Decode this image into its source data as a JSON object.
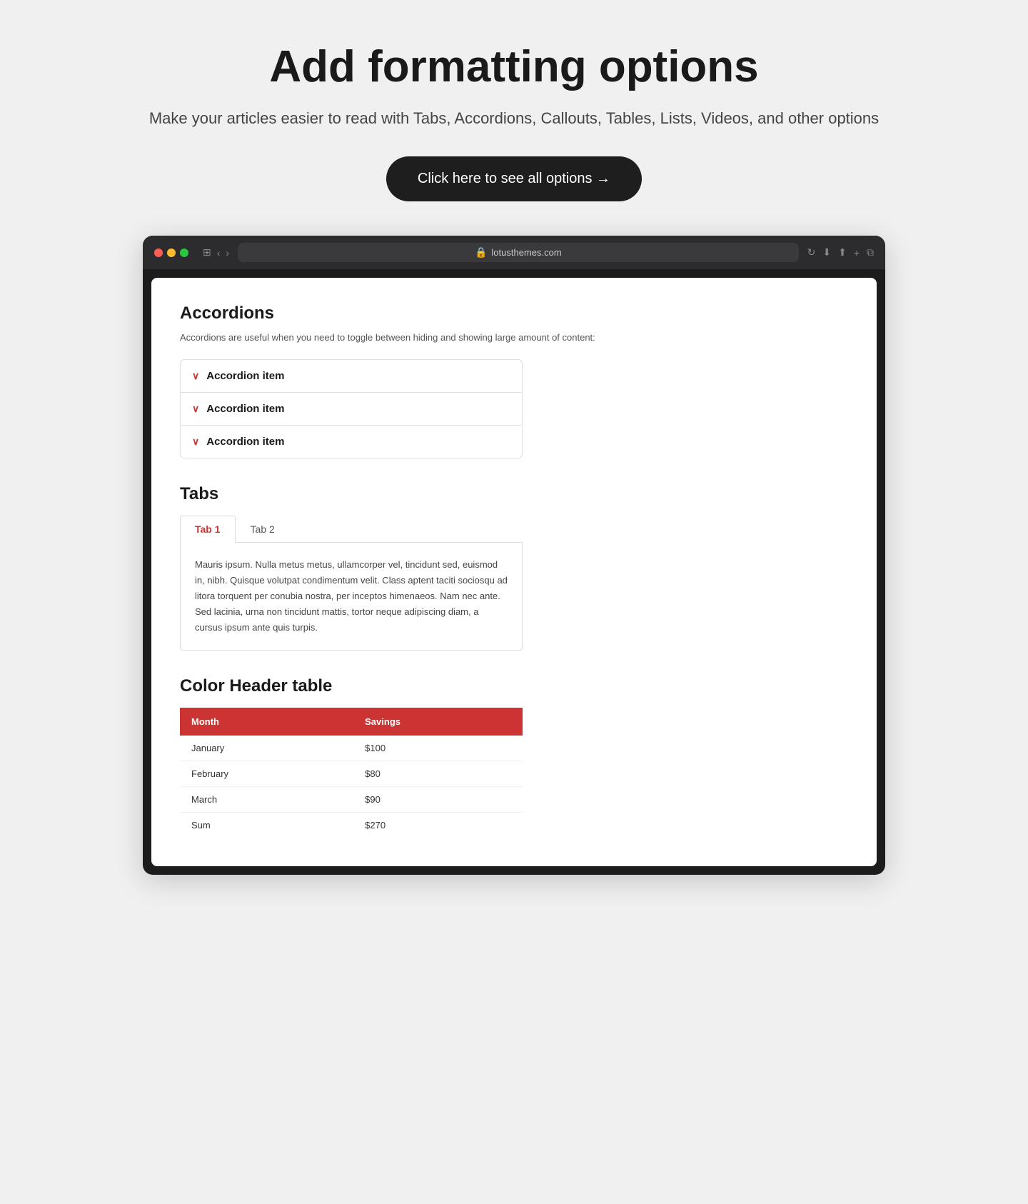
{
  "hero": {
    "title": "Add formatting options",
    "subtitle": "Make your articles easier to read with Tabs, Accordions,\nCallouts, Tables, Lists, Videos, and other options",
    "cta_label": "Click here to see all options →"
  },
  "browser": {
    "url": "lotusthemes.com",
    "dots": [
      "red",
      "yellow",
      "green"
    ]
  },
  "accordions_section": {
    "title": "Accordions",
    "description": "Accordions are useful when you need to toggle between hiding and showing large amount of\ncontent:",
    "items": [
      {
        "label": "Accordion item"
      },
      {
        "label": "Accordion item"
      },
      {
        "label": "Accordion item"
      }
    ]
  },
  "tabs_section": {
    "title": "Tabs",
    "tabs": [
      {
        "label": "Tab 1",
        "active": true
      },
      {
        "label": "Tab 2",
        "active": false
      }
    ],
    "active_content": "Mauris ipsum. Nulla metus metus, ullamcorper vel, tincidunt sed, euismod in, nibh. Quisque volutpat condimentum velit. Class aptent taciti sociosqu ad litora torquent per conubia nostra, per inceptos himenaeos. Nam nec ante. Sed lacinia, urna non tincidunt mattis, tortor neque adipiscing diam, a cursus ipsum ante quis turpis."
  },
  "table_section": {
    "title": "Color Header table",
    "headers": [
      "Month",
      "Savings"
    ],
    "rows": [
      [
        "January",
        "$100"
      ],
      [
        "February",
        "$80"
      ],
      [
        "March",
        "$90"
      ],
      [
        "Sum",
        "$270"
      ]
    ]
  },
  "icons": {
    "chevron_down": "∨",
    "lock": "🔒",
    "arrow_right": "→",
    "refresh": "↻",
    "share": "⬆",
    "plus": "+",
    "tabs_icon": "⊞",
    "back": "‹",
    "forward": "›"
  }
}
